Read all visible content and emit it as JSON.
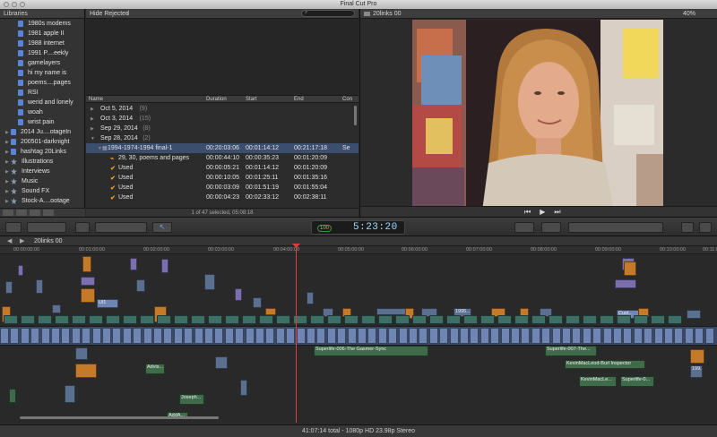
{
  "window": {
    "title": "Final Cut Pro"
  },
  "library": {
    "header": "Libraries",
    "items": [
      {
        "label": "1980s modems",
        "kind": "event",
        "indent": 2
      },
      {
        "label": "1981 apple II",
        "kind": "event",
        "indent": 2
      },
      {
        "label": "1988 internet",
        "kind": "event",
        "indent": 2
      },
      {
        "label": "1991 P....eekly",
        "kind": "event",
        "indent": 2
      },
      {
        "label": "gamelayers",
        "kind": "event",
        "indent": 2
      },
      {
        "label": "hi my name is",
        "kind": "event",
        "indent": 2
      },
      {
        "label": "poems....pages",
        "kind": "event",
        "indent": 2
      },
      {
        "label": "RSI",
        "kind": "event",
        "indent": 2
      },
      {
        "label": "werid and lonely",
        "kind": "event",
        "indent": 2
      },
      {
        "label": "woah",
        "kind": "event",
        "indent": 2
      },
      {
        "label": "wrist pain",
        "kind": "event",
        "indent": 2
      },
      {
        "label": "2014 Ju....otageIn",
        "kind": "folder",
        "indent": 1
      },
      {
        "label": "200501-darknight",
        "kind": "folder",
        "indent": 1
      },
      {
        "label": "hashtag 20Links",
        "kind": "folder",
        "indent": 1
      },
      {
        "label": "Illustrations",
        "kind": "star",
        "indent": 1
      },
      {
        "label": "Interviews",
        "kind": "star",
        "indent": 1
      },
      {
        "label": "Music",
        "kind": "star",
        "indent": 1
      },
      {
        "label": "Sound FX",
        "kind": "star",
        "indent": 1
      },
      {
        "label": "Stock-A....ootage",
        "kind": "star",
        "indent": 1
      }
    ]
  },
  "browser": {
    "filter": "Hide Rejected",
    "columns": [
      "Name",
      "Duration",
      "Start",
      "End",
      "Con"
    ],
    "rows": [
      {
        "name": "Oct 5, 2014",
        "count": "(9)",
        "duration": "",
        "start": "",
        "end": "",
        "con": "",
        "level": 0
      },
      {
        "name": "Oct 3, 2014",
        "count": "(15)",
        "duration": "",
        "start": "",
        "end": "",
        "con": "",
        "level": 0
      },
      {
        "name": "Sep 29, 2014",
        "count": "(8)",
        "duration": "",
        "start": "",
        "end": "",
        "con": "",
        "level": 0
      },
      {
        "name": "Sep 28, 2014",
        "count": "(2)",
        "duration": "",
        "start": "",
        "end": "",
        "con": "",
        "level": 0
      },
      {
        "name": "1994-1974-1994 final-1",
        "count": "",
        "duration": "00:20:03:06",
        "start": "00:01:14:12",
        "end": "00:21:17:18",
        "con": "Se",
        "level": 1
      },
      {
        "name": "29, 30, poems and pages",
        "count": "",
        "duration": "00:00:44:10",
        "start": "00:00:35:23",
        "end": "00:01:20:09",
        "con": "",
        "level": 2
      },
      {
        "name": "Used",
        "count": "",
        "duration": "00:00:05:21",
        "start": "00:01:14:12",
        "end": "00:01:20:09",
        "con": "",
        "level": 2
      },
      {
        "name": "Used",
        "count": "",
        "duration": "00:00:10:05",
        "start": "00:01:25:11",
        "end": "00:01:35:16",
        "con": "",
        "level": 2
      },
      {
        "name": "Used",
        "count": "",
        "duration": "00:00:03:09",
        "start": "00:01:51:19",
        "end": "00:01:55:04",
        "con": "",
        "level": 2
      },
      {
        "name": "Used",
        "count": "",
        "duration": "00:00:04:23",
        "start": "00:02:33:12",
        "end": "00:02:38:11",
        "con": "",
        "level": 2
      }
    ],
    "footer": "1 of 47 selected, 05:08:18"
  },
  "viewer": {
    "title": "20links 00",
    "zoom": "40%"
  },
  "toolbar": {
    "timecode": "5:23:20",
    "timecode_prefix": "100"
  },
  "timeline": {
    "project": "20links 00",
    "ruler": [
      "00:00:00:00",
      "00:01:00:00",
      "00:02:00:00",
      "00:03:00:00",
      "00:04:00:00",
      "00:05:00:00",
      "00:06:00:00",
      "00:07:00:00",
      "00:08:00:00",
      "00:09:00:00",
      "00:10:00:00",
      "00:11:00:00"
    ],
    "labels": {
      "superlife1": "Superlife-006-The Gasmer-Sync",
      "superlife2": "Superlife-007-The...",
      "kevin1": "KevinMacLeod-Burl Inspector",
      "kevin2": "KevinMacLe...",
      "superlife3": "Superlife-0...",
      "joseph": "Joseph...",
      "advis": "Advis...",
      "adda": "AddA...",
      "cust": "Cust...",
      "ul": "Ul1",
      "y1995": "1995...",
      "n199": "199..."
    }
  },
  "status": {
    "text": "41:07:14 total - 1080p HD 23.98p Stereo"
  }
}
